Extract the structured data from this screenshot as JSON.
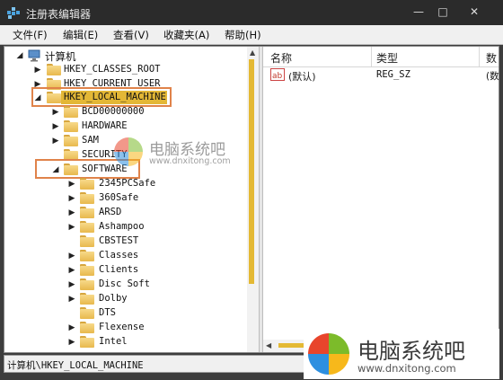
{
  "window": {
    "title": "注册表编辑器"
  },
  "menu": [
    "文件(F)",
    "编辑(E)",
    "查看(V)",
    "收藏夹(A)",
    "帮助(H)"
  ],
  "tree": {
    "root": "计算机",
    "hives": [
      "HKEY_CLASSES_ROOT",
      "HKEY_CURRENT_USER",
      "HKEY_LOCAL_MACHINE"
    ],
    "hklm_children": [
      "BCD00000000",
      "HARDWARE",
      "SAM",
      "SECURITY",
      "SOFTWARE"
    ],
    "software_children": [
      "2345PCSafe",
      "360Safe",
      "ARSD",
      "Ashampoo",
      "CBSTEST",
      "Classes",
      "Clients",
      "Disc Soft",
      "Dolby",
      "DTS",
      "Flexense",
      "Intel"
    ]
  },
  "list": {
    "headers": [
      "名称",
      "类型",
      "数"
    ],
    "rows": [
      {
        "name": "(默认)",
        "type": "REG_SZ",
        "data": "(数"
      }
    ]
  },
  "status": "计算机\\HKEY_LOCAL_MACHINE",
  "watermark": {
    "center_text": "电脑系统吧",
    "center_url": "www.dnxitong.com",
    "corner_text": "电脑系统吧",
    "corner_url": "www.dnxitong.com"
  },
  "colors": {
    "highlight": "#e0834a",
    "selection": "#e3b736"
  }
}
